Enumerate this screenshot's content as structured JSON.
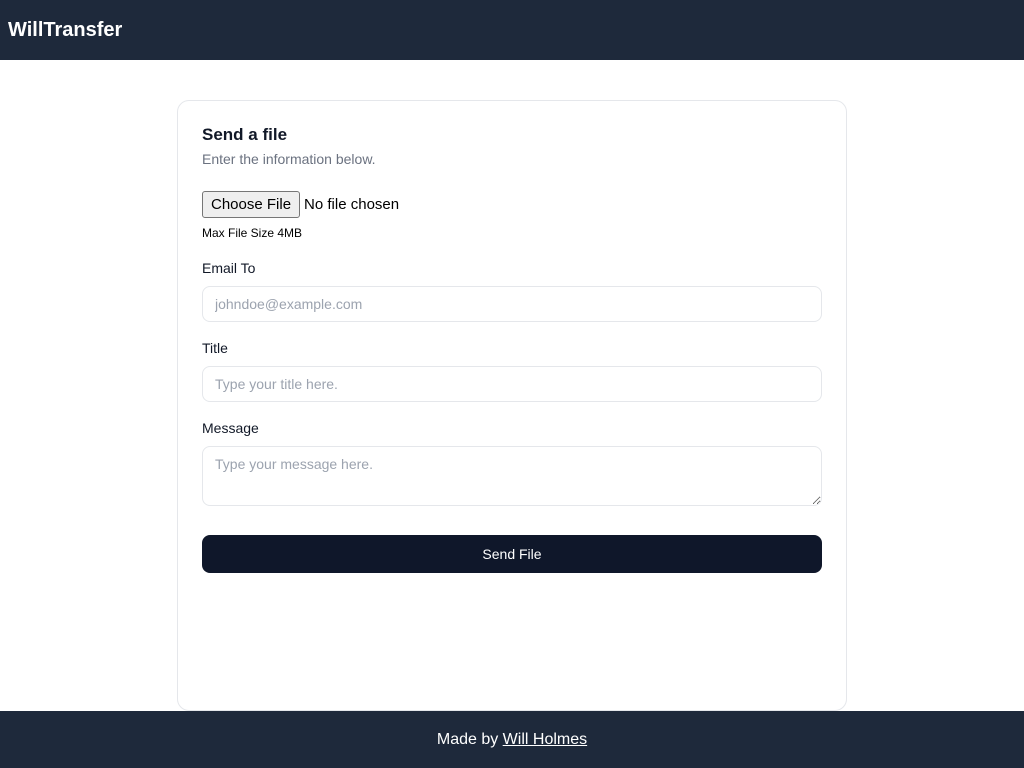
{
  "header": {
    "title": "WillTransfer"
  },
  "card": {
    "title": "Send a file",
    "subtitle": "Enter the information below."
  },
  "fileInput": {
    "chooseLabel": "Choose File",
    "noFileText": "No file chosen",
    "maxSizeText": "Max File Size 4MB"
  },
  "emailField": {
    "label": "Email To",
    "placeholder": "johndoe@example.com",
    "value": ""
  },
  "titleField": {
    "label": "Title",
    "placeholder": "Type your title here.",
    "value": ""
  },
  "messageField": {
    "label": "Message",
    "placeholder": "Type your message here.",
    "value": ""
  },
  "submitButton": {
    "label": "Send File"
  },
  "footer": {
    "madeBy": "Made by ",
    "authorName": "Will Holmes"
  }
}
